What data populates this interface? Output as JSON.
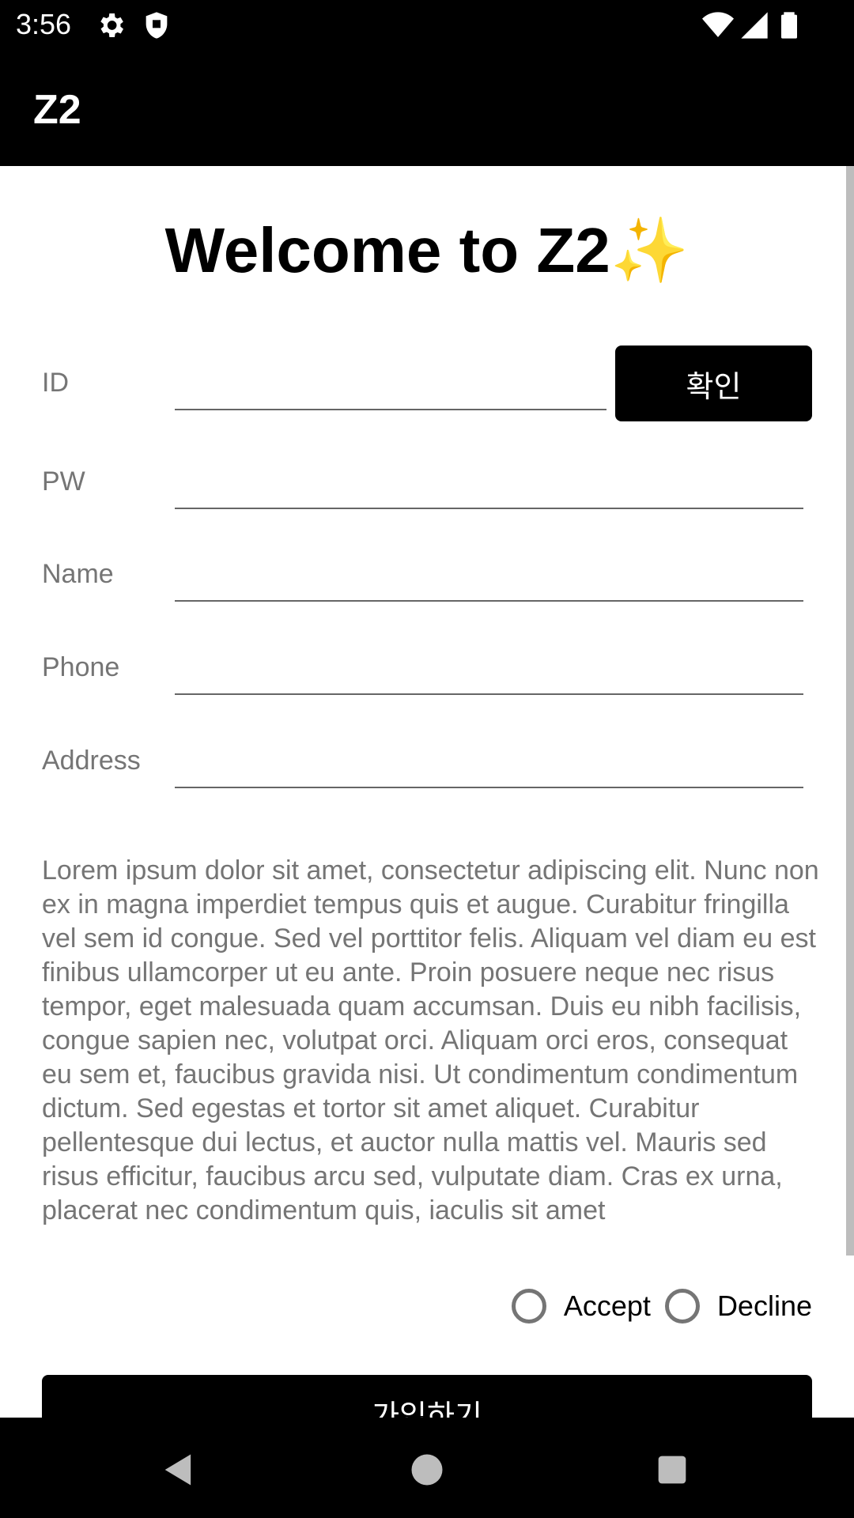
{
  "status_bar": {
    "time": "3:56",
    "icons": [
      "gear-icon",
      "shield-icon",
      "wifi-icon",
      "signal-icon",
      "battery-icon"
    ]
  },
  "app_bar": {
    "title": "Z2"
  },
  "welcome": {
    "title": "Welcome to Z2✨"
  },
  "form": {
    "id_label": "ID",
    "id_value": "",
    "confirm_label": "확인",
    "pw_label": "PW",
    "pw_value": "",
    "name_label": "Name",
    "name_value": "",
    "phone_label": "Phone",
    "phone_value": "",
    "address_label": "Address",
    "address_value": ""
  },
  "terms": {
    "text": "Lorem ipsum dolor sit amet, consectetur adipiscing elit. Nunc non ex in magna imperdiet tempus quis et augue. Curabitur fringilla vel sem id congue. Sed vel porttitor felis. Aliquam vel diam eu est finibus ullamcorper ut eu ante. Proin posuere neque nec risus tempor, eget malesuada quam accumsan. Duis eu nibh facilisis, congue sapien nec, volutpat orci. Aliquam orci eros, consequat eu sem et, faucibus gravida nisi. Ut condimentum condimentum dictum. Sed egestas et tortor sit amet aliquet.  Curabitur pellentesque dui lectus, et auctor nulla mattis vel. Mauris sed risus efficitur, faucibus arcu sed, vulputate diam. Cras ex urna, placerat nec condimentum quis, iaculis sit amet"
  },
  "consent": {
    "accept_label": "Accept",
    "decline_label": "Decline",
    "selected": ""
  },
  "signup": {
    "label": "가입하기"
  },
  "nav_bar": {
    "icons": [
      "back-icon",
      "home-icon",
      "recents-icon"
    ]
  },
  "colors": {
    "bar_bg": "#000000",
    "label_gray": "#757575",
    "button_bg": "#000000",
    "button_text": "#ffffff"
  }
}
